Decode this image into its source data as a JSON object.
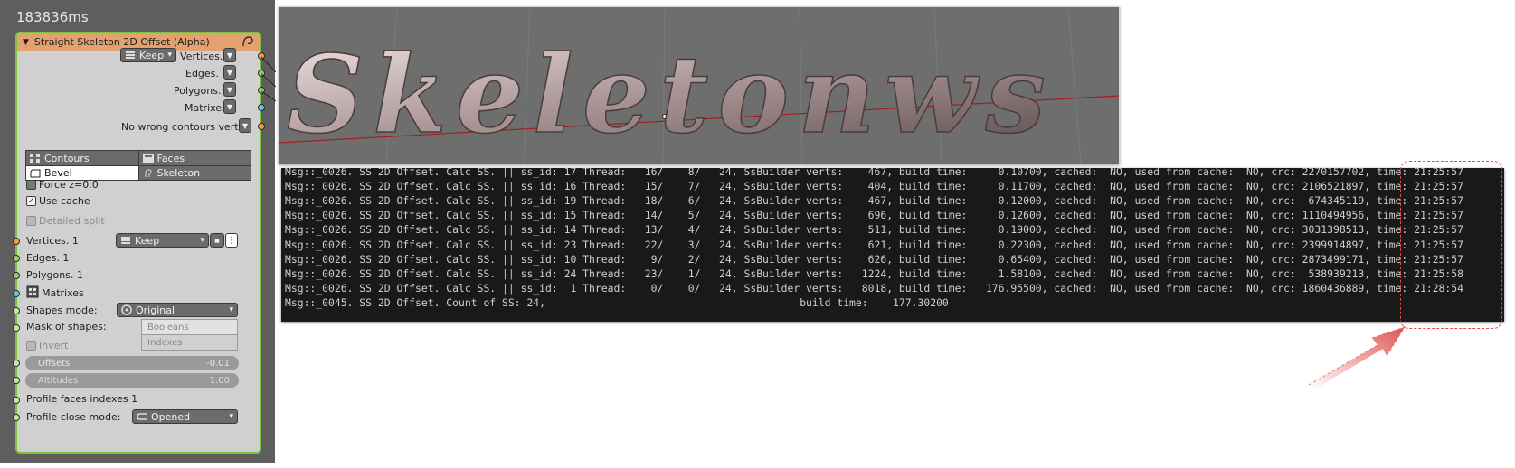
{
  "timing": "183836ms",
  "node": {
    "title": "Straight Skeleton 2D Offset (Alpha)",
    "outputs": {
      "keep_label": "Keep",
      "vertices": "Vertices. 1",
      "edges": "Edges. 1",
      "polygons": "Polygons. 1",
      "matrixes": "Matrixes",
      "wrong": "No wrong contours verts"
    },
    "modes": {
      "contours": "Contours",
      "faces": "Faces",
      "bevel": "Bevel",
      "skeleton": "Skeleton",
      "selected": "Bevel"
    },
    "force_z": "Force z=0.0",
    "use_cache": "Use cache",
    "use_cache_checked": true,
    "detailed_split": "Detailed split",
    "inputs": {
      "vertices": "Vertices. 1",
      "vertices_keep": "Keep",
      "edges": "Edges. 1",
      "polygons": "Polygons. 1",
      "matrixes": "Matrixes",
      "shapes_mode_label": "Shapes mode:",
      "shapes_mode_value": "Original",
      "mask_label": "Mask of shapes:",
      "mask_options": [
        "Booleans",
        "Indexes"
      ],
      "invert": "Invert",
      "offsets_label": "Offsets",
      "offsets_value": "-0.01",
      "altitudes_label": "Altitudes",
      "altitudes_value": "1.00",
      "profile_faces": "Profile faces indexes 1",
      "profile_close_label": "Profile close mode:",
      "profile_close_value": "Opened"
    }
  },
  "viewport": {
    "word": "Skeletonws",
    "letter_fill": "#b9a4a4",
    "axis_color": "#a01e1e"
  },
  "console": {
    "lines": [
      {
        "a": "Msg::_0026. SS 2D Offset. Calc SS. ",
        "b": "||",
        "c": " ss_id: 17 Thread:   16/    8/   24, SsBuilder verts:    467, build time:     0.10700, cached:  NO, used from cache:  NO, crc: 2270157702, time: 21:25:57"
      },
      {
        "a": "Msg::_0026. SS 2D Offset. Calc SS. ",
        "b": "||",
        "c": " ss_id: 16 Thread:   15/    7/   24, SsBuilder verts:    404, build time:     0.11700, cached:  NO, used from cache:  NO, crc: 2106521897, time: 21:25:57"
      },
      {
        "a": "Msg::_0026. SS 2D Offset. Calc SS. ",
        "b": "||",
        "c": " ss_id: 19 Thread:   18/    6/   24, SsBuilder verts:    467, build time:     0.12000, cached:  NO, used from cache:  NO, crc:  674345119, time: 21:25:57"
      },
      {
        "a": "Msg::_0026. SS 2D Offset. Calc SS. ",
        "b": "||",
        "c": " ss_id: 15 Thread:   14/    5/   24, SsBuilder verts:    696, build time:     0.12600, cached:  NO, used from cache:  NO, crc: 1110494956, time: 21:25:57"
      },
      {
        "a": "Msg::_0026. SS 2D Offset. Calc SS. ",
        "b": "||",
        "c": " ss_id: 14 Thread:   13/    4/   24, SsBuilder verts:    511, build time:     0.19000, cached:  NO, used from cache:  NO, crc: 3031398513, time: 21:25:57"
      },
      {
        "a": "Msg::_0026. SS 2D Offset. Calc SS. ",
        "b": "||",
        "c": " ss_id: 23 Thread:   22/    3/   24, SsBuilder verts:    621, build time:     0.22300, cached:  NO, used from cache:  NO, crc: 2399914897, time: 21:25:57"
      },
      {
        "a": "Msg::_0026. SS 2D Offset. Calc SS. ",
        "b": "||",
        "c": " ss_id: 10 Thread:    9/    2/   24, SsBuilder verts:    626, build time:     0.65400, cached:  NO, used from cache:  NO, crc: 2873499171, time: 21:25:57"
      },
      {
        "a": "Msg::_0026. SS 2D Offset. Calc SS. ",
        "b": "||",
        "c": " ss_id: 24 Thread:   23/    1/   24, SsBuilder verts:   1224, build time:     1.58100, cached:  NO, used from cache:  NO, crc:  538939213, time: 21:25:58"
      },
      {
        "a": "Msg::_0026. SS 2D Offset. Calc SS. ",
        "b": "||",
        "c": " ss_id:  1 Thread:    0/    0/   24, SsBuilder verts:   8018, build time:   176.95500, cached:  NO, used from cache:  NO, crc: 1860436889, time: 21:28:54"
      },
      {
        "a": "Msg::_0045. SS 2D Offset. Count of SS: 24,                                         build time:    177.30200",
        "b": "",
        "c": ""
      }
    ]
  },
  "annotation": {
    "box_color": "#e04b4b"
  }
}
